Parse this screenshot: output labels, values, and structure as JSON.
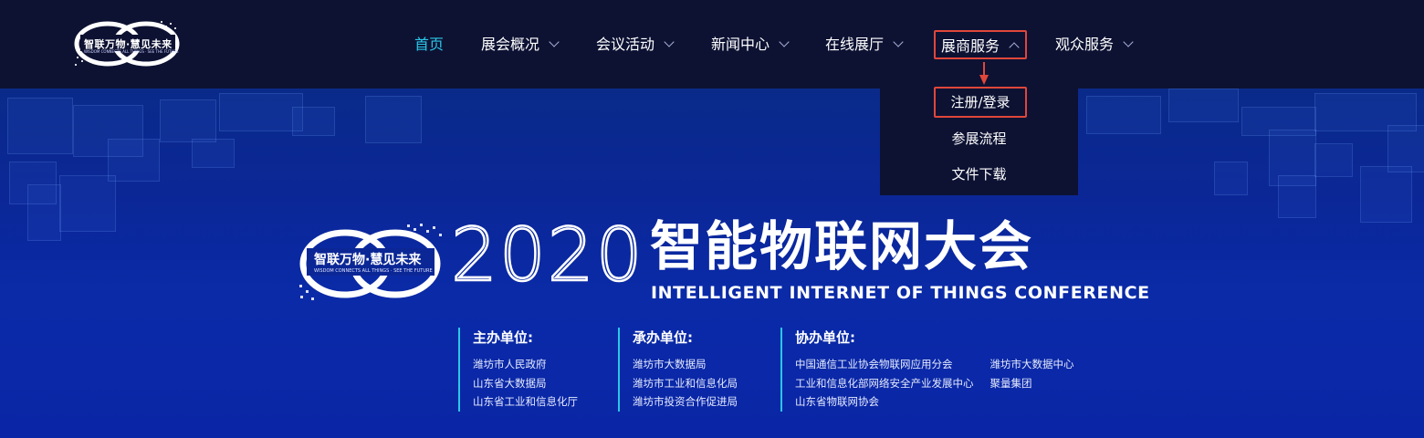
{
  "logo": {
    "brand": "智联万物·慧见未来",
    "tagline": "WISDOM CONNECTS ALL THINGS · SEE THE FUTURE"
  },
  "nav": {
    "items": [
      {
        "label": "首页",
        "active": true
      },
      {
        "label": "展会概况",
        "dropdown": true
      },
      {
        "label": "会议活动",
        "dropdown": true
      },
      {
        "label": "新闻中心",
        "dropdown": true
      },
      {
        "label": "在线展厅",
        "dropdown": true
      },
      {
        "label": "展商服务",
        "dropdown": true,
        "open": true
      },
      {
        "label": "观众服务",
        "dropdown": true
      }
    ]
  },
  "dropdown": {
    "items": [
      {
        "label": "注册/登录"
      },
      {
        "label": "参展流程"
      },
      {
        "label": "文件下载"
      }
    ]
  },
  "hero": {
    "year": "2020",
    "title_cn": "智能物联网大会",
    "title_en": "INTELLIGENT INTERNET OF THINGS CONFERENCE",
    "organizers": [
      {
        "title": "主办单位:",
        "items": [
          "潍坊市人民政府",
          "山东省大数据局",
          "山东省工业和信息化厅"
        ]
      },
      {
        "title": "承办单位:",
        "items": [
          "潍坊市大数据局",
          "潍坊市工业和信息化局",
          "潍坊市投资合作促进局"
        ]
      },
      {
        "title": "协办单位:",
        "items": [
          "中国通信工业协会物联网应用分会",
          "工业和信息化部网络安全产业发展中心",
          "山东省物联网协会"
        ],
        "items2": [
          "潍坊市大数据中心",
          "聚量集团"
        ]
      }
    ]
  },
  "colors": {
    "nav_bg": "#0d1233",
    "active": "#2bc7e8",
    "highlight": "#e0463a",
    "hero_bg": "#0a2aa8"
  }
}
